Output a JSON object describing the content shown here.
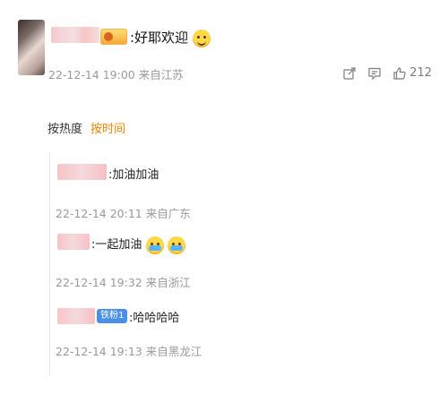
{
  "comment": {
    "text": ":好耶欢迎",
    "time": "22-12-14 19:00",
    "location": "来自江苏",
    "like_count": "212"
  },
  "sort_tabs": [
    {
      "label": "按热度",
      "active": false
    },
    {
      "label": "按时间",
      "active": true
    }
  ],
  "replies": [
    {
      "text": ":加油加油",
      "time": "22-12-14 20:11",
      "location": "来自广东"
    },
    {
      "text": ":一起加油",
      "time": "22-12-14 19:32",
      "location": "来自浙江"
    },
    {
      "text": ":哈哈哈哈",
      "time": "22-12-14 19:13",
      "location": "来自黑龙江",
      "badge": "铁粉1"
    }
  ],
  "colors": {
    "accent": "#ff8200",
    "meta": "#9a9a9a",
    "badge_blue": "#4a8fe7"
  },
  "icons": [
    "share-icon",
    "comment-icon",
    "like-icon"
  ]
}
